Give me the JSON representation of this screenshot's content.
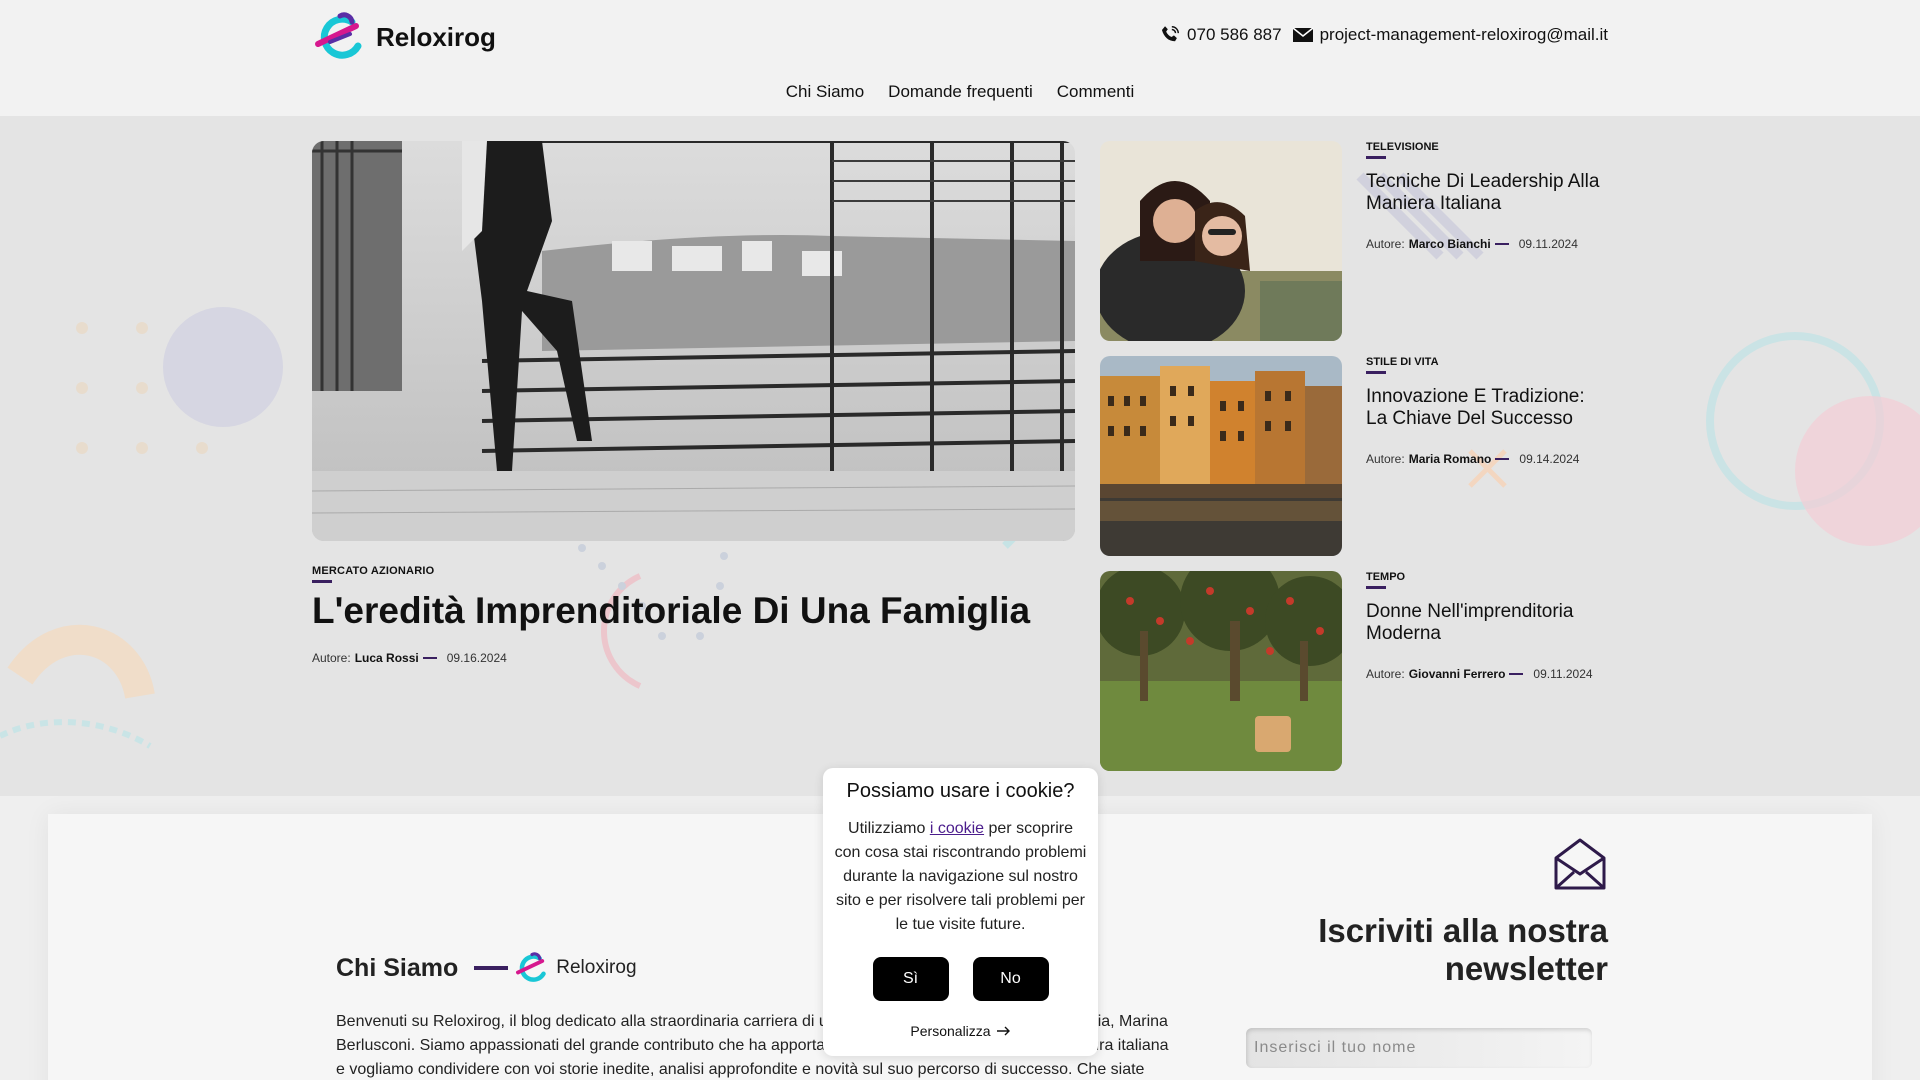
{
  "header": {
    "brand": "Reloxirog",
    "phone": "070 586 887",
    "email": "project-management-reloxirog@mail.it"
  },
  "nav": [
    "Chi Siamo",
    "Domande frequenti",
    "Commenti"
  ],
  "featured": {
    "category": "MERCATO AZIONARIO",
    "title": "L'eredità Imprenditoriale Di Una Famiglia",
    "author_label": "Autore:",
    "author": "Luca Rossi",
    "date": "09.16.2024"
  },
  "side_articles": [
    {
      "category": "TELEVISIONE",
      "title": "Tecniche Di Leadership Alla Maniera Italiana",
      "author_label": "Autore:",
      "author": "Marco Bianchi",
      "date": "09.11.2024"
    },
    {
      "category": "STILE DI VITA",
      "title": "Innovazione E Tradizione: La Chiave Del Successo",
      "author_label": "Autore:",
      "author": "Maria Romano",
      "date": "09.14.2024"
    },
    {
      "category": "TEMPO",
      "title": "Donne Nell'imprenditoria Moderna",
      "author_label": "Autore:",
      "author": "Giovanni Ferrero",
      "date": "09.11.2024"
    }
  ],
  "about": {
    "title": "Chi Siamo",
    "brand": "Reloxirog",
    "text": "Benvenuti su Reloxirog, il blog dedicato alla straordinaria carriera di una delle imprenditrici più influenti d'Italia, Marina Berlusconi. Siamo appassionati del grande contributo che ha apportato al mondo imprenditoriale e alla cultura italiana e vogliamo condividere con voi storie inedite, analisi approfondite e novità sul suo percorso di successo. Che siate"
  },
  "newsletter": {
    "title": "Iscriviti alla nostra newsletter",
    "name_placeholder": "Inserisci il tuo nome"
  },
  "cookie": {
    "title": "Possiamo usare i cookie?",
    "text_before": "Utilizziamo ",
    "link": "i cookie",
    "text_after": " per scoprire con cosa stai riscontrando problemi durante la navigazione sul nostro sito e per risolvere tali problemi per le tue visite future.",
    "yes": "Sì",
    "no": "No",
    "customize": "Personalizza"
  },
  "colors": {
    "accent": "#3a2060",
    "logo_cyan": "#19c7d6",
    "logo_magenta": "#d6188e",
    "logo_purple": "#5a2ea6"
  },
  "icons": [
    "logo-icon",
    "phone-icon",
    "mail-icon",
    "envelope-open-icon",
    "arrow-right-icon"
  ]
}
